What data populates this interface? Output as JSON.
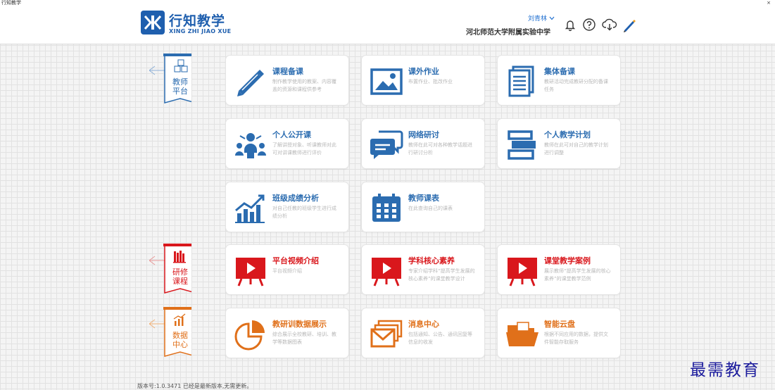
{
  "window": {
    "title": "行知教学",
    "close_glyph": "×"
  },
  "header": {
    "logo_title": "行知教学",
    "logo_subtitle": "XING ZHI JIAO XUE",
    "user_name": "刘青林",
    "school": "河北师范大学附属实验中学",
    "icons": [
      "bell-icon",
      "help-icon",
      "cloud-download-icon",
      "pen-icon"
    ]
  },
  "sections": [
    {
      "label_line1": "教师",
      "label_line2": "平台",
      "color": "#2b6cb0",
      "icon": "abc-blocks-icon"
    },
    {
      "label_line1": "研修",
      "label_line2": "课程",
      "color": "#d9171c",
      "icon": "books-icon"
    },
    {
      "label_line1": "数据",
      "label_line2": "中心",
      "color": "#e0701a",
      "icon": "chart-icon"
    }
  ],
  "cards": {
    "lesson_prep": {
      "title": "课程备课",
      "desc": "制作教学使用的教案、内容覆盖的资源和课程供参考"
    },
    "homework": {
      "title": "课外作业",
      "desc": "布置作业、批改作业"
    },
    "group_prep": {
      "title": "集体备课",
      "desc": "教研活动完成教研分配的备课任务"
    },
    "open_class": {
      "title": "个人公开课",
      "desc": "了解讲授对象、听课教师对此可对讲课教师进行评价"
    },
    "online_research": {
      "title": "网络研讨",
      "desc": "教师在此可对各种教学话题进行研讨分析"
    },
    "teaching_plan": {
      "title": "个人教学计划",
      "desc": "教师在此可对自己的教学计划进行调整"
    },
    "grade_analysis": {
      "title": "班级成绩分析",
      "desc": "对自己任教的班级学生进行成绩分析"
    },
    "schedule": {
      "title": "教师课表",
      "desc": "在此查询自己的课表"
    },
    "platform_video": {
      "title": "平台视频介绍",
      "desc": "平台视频介绍"
    },
    "core_literacy": {
      "title": "学科核心素养",
      "desc": "专家介绍学科“提高学生发展的核心素养”的课堂教学设计"
    },
    "classroom_cases": {
      "title": "课堂教学案例",
      "desc": "展示教师“提高学生发展的核心素养”的课堂教学范例"
    },
    "data_display": {
      "title": "教研训数据展示",
      "desc": "综合展示全校教研、培训、教学等数据图表"
    },
    "message_center": {
      "title": "消息中心",
      "desc": "包括通知、公告、通讯回复等信息的收发"
    },
    "cloud_disk": {
      "title": "智能云盘",
      "desc": "根据不同应用的数据，提供文件智能存取服务"
    }
  },
  "footer": {
    "version": "版本号:1.0.3471 已经是最新版本,无需更新。"
  },
  "watermark": "最需教育"
}
